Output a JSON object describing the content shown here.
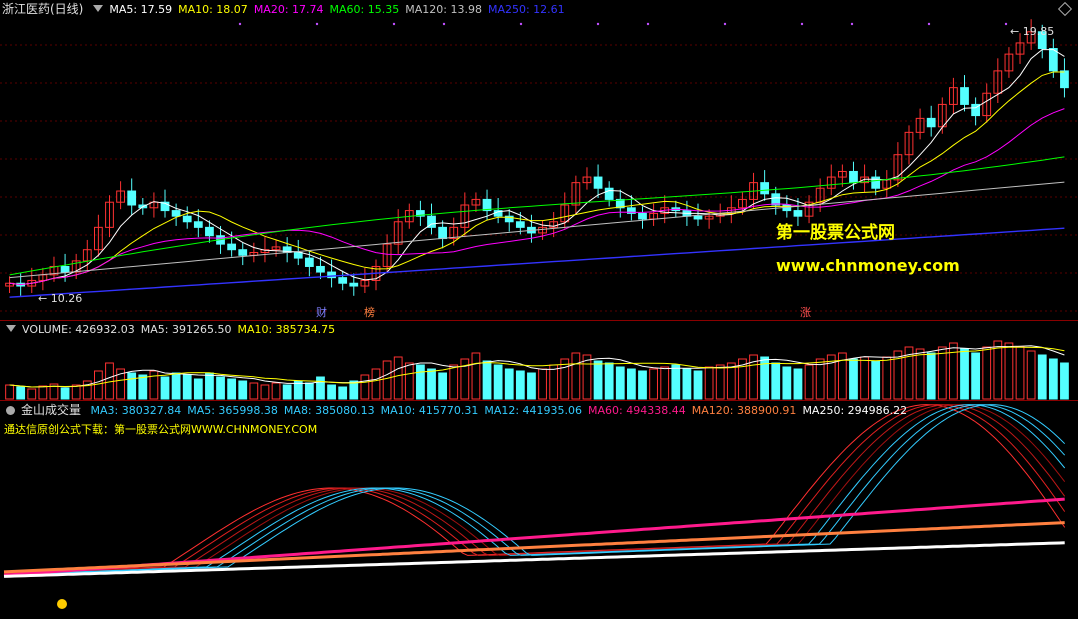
{
  "header": {
    "stock_name": "浙江医药(日线)",
    "ma_items": [
      {
        "label": "MA5: 17.59",
        "color": "#ffffff"
      },
      {
        "label": "MA10: 18.07",
        "color": "#ffff00"
      },
      {
        "label": "MA20: 17.74",
        "color": "#ff00ff"
      },
      {
        "label": "MA60: 15.35",
        "color": "#00ff00"
      },
      {
        "label": "MA120: 13.98",
        "color": "#c0c0c0"
      },
      {
        "label": "MA250: 12.61",
        "color": "#3333ff"
      }
    ]
  },
  "price_pane": {
    "high_label": "19.85",
    "low_label": "10.26",
    "markers": [
      {
        "text": "财",
        "color": "#7f7fff"
      },
      {
        "text": "榜",
        "color": "#ff8040"
      },
      {
        "text": "涨",
        "color": "#ff5050"
      }
    ],
    "watermark_title": "第一股票公式网",
    "watermark_url": "www.chnmoney.com"
  },
  "volume_header": {
    "items": [
      {
        "label": "VOLUME: 426932.03",
        "color": "#e0e0e0"
      },
      {
        "label": "MA5: 391265.50",
        "color": "#e0e0e0"
      },
      {
        "label": "MA10: 385734.75",
        "color": "#ffff00"
      }
    ]
  },
  "indicator_header": {
    "name": "金山成交量",
    "items": [
      {
        "label": "MA3: 380327.84",
        "color": "#33ccff"
      },
      {
        "label": "MA5: 365998.38",
        "color": "#33ccff"
      },
      {
        "label": "MA8: 385080.13",
        "color": "#33ccff"
      },
      {
        "label": "MA10: 415770.31",
        "color": "#33ccff"
      },
      {
        "label": "MA12: 441935.06",
        "color": "#33ccff"
      },
      {
        "label": "MA60: 494338.44",
        "color": "#ff1a8c"
      },
      {
        "label": "MA120: 388900.91",
        "color": "#ff8040"
      },
      {
        "label": "MA250: 294986.22",
        "color": "#ffffff"
      }
    ],
    "subtitle": "通达信原创公式下载：第一股票公式网WWW.CHNMONEY.COM"
  },
  "chart_data": {
    "type": "candlestick",
    "title": "浙江医药(日线)",
    "price_range": [
      10.0,
      20.2
    ],
    "closes": [
      10.6,
      10.5,
      10.7,
      10.9,
      11.2,
      11.0,
      11.4,
      11.8,
      12.6,
      13.5,
      13.9,
      13.4,
      13.3,
      13.5,
      13.2,
      13.0,
      12.8,
      12.6,
      12.3,
      12.0,
      11.8,
      11.6,
      11.7,
      11.8,
      11.9,
      11.7,
      11.5,
      11.2,
      11.0,
      10.8,
      10.6,
      10.5,
      10.7,
      11.2,
      12.0,
      12.8,
      13.2,
      13.0,
      12.6,
      12.2,
      12.6,
      13.4,
      13.6,
      13.2,
      13.0,
      12.8,
      12.6,
      12.4,
      12.6,
      12.8,
      13.4,
      14.2,
      14.4,
      14.0,
      13.6,
      13.3,
      13.1,
      12.9,
      13.1,
      13.3,
      13.2,
      13.0,
      12.9,
      13.0,
      13.1,
      13.3,
      13.6,
      14.2,
      13.8,
      13.4,
      13.2,
      13.0,
      13.5,
      14.0,
      14.4,
      14.6,
      14.2,
      14.4,
      14.0,
      14.3,
      15.2,
      16.0,
      16.5,
      16.2,
      17.0,
      17.6,
      17.0,
      16.6,
      17.4,
      18.2,
      18.8,
      19.2,
      19.6,
      19.0,
      18.2,
      17.6
    ]
  },
  "volume_data": {
    "values": [
      14,
      12,
      10,
      13,
      15,
      11,
      14,
      18,
      28,
      36,
      30,
      26,
      24,
      28,
      22,
      26,
      24,
      20,
      26,
      22,
      20,
      18,
      16,
      14,
      16,
      14,
      18,
      16,
      22,
      14,
      12,
      18,
      24,
      30,
      38,
      42,
      36,
      34,
      30,
      26,
      34,
      40,
      46,
      38,
      34,
      30,
      28,
      26,
      30,
      34,
      40,
      46,
      44,
      38,
      36,
      32,
      30,
      28,
      30,
      32,
      34,
      30,
      28,
      32,
      34,
      36,
      40,
      44,
      42,
      36,
      32,
      30,
      34,
      40,
      44,
      46,
      40,
      42,
      38,
      42,
      48,
      52,
      50,
      46,
      52,
      56,
      50,
      46,
      52,
      58,
      56,
      52,
      48,
      44,
      40,
      36
    ]
  }
}
